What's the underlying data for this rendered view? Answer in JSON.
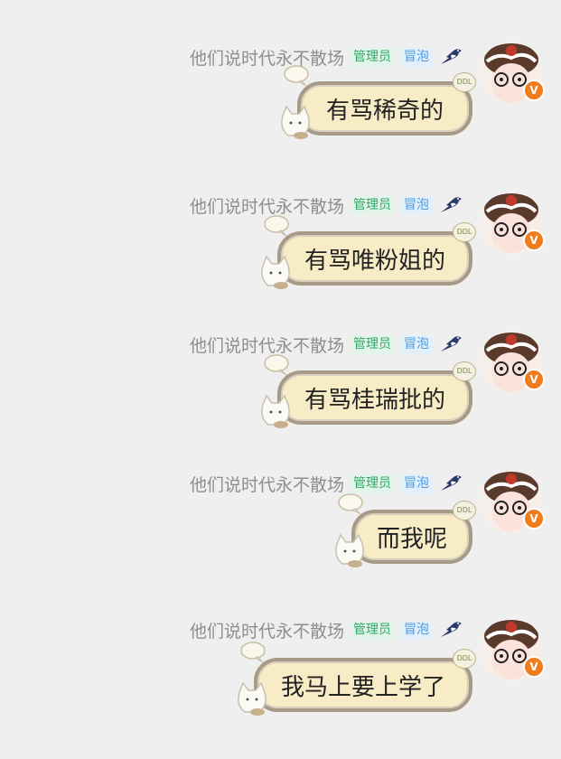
{
  "messages": [
    {
      "nickname": "他们说时代永不散场",
      "tag_admin": "管理员",
      "tag_bubble": "冒泡",
      "text": "有骂稀奇的",
      "badge": "V",
      "sticker": "DDL"
    },
    {
      "nickname": "他们说时代永不散场",
      "tag_admin": "管理员",
      "tag_bubble": "冒泡",
      "text": "有骂唯粉姐的",
      "badge": "V",
      "sticker": "DDL"
    },
    {
      "nickname": "他们说时代永不散场",
      "tag_admin": "管理员",
      "tag_bubble": "冒泡",
      "text": "有骂桂瑞批的",
      "badge": "V",
      "sticker": "DDL"
    },
    {
      "nickname": "他们说时代永不散场",
      "tag_admin": "管理员",
      "tag_bubble": "冒泡",
      "text": "而我呢",
      "badge": "V",
      "sticker": "DDL"
    },
    {
      "nickname": "他们说时代永不散场",
      "tag_admin": "管理员",
      "tag_bubble": "冒泡",
      "text": "我马上要上学了",
      "badge": "V",
      "sticker": "DDL"
    }
  ],
  "colors": {
    "background": "#efefef",
    "bubble_fill": "#f8ecc6",
    "bubble_border": "#a79a86",
    "admin_tag": "#2fa865",
    "bubble_tag": "#4a9ce0",
    "vip_badge": "#f07c1e"
  },
  "icons": [
    "magpie-bird-icon",
    "verified-v-icon",
    "cat-sticker-icon",
    "speech-puff-icon",
    "ddl-sticker-icon"
  ]
}
